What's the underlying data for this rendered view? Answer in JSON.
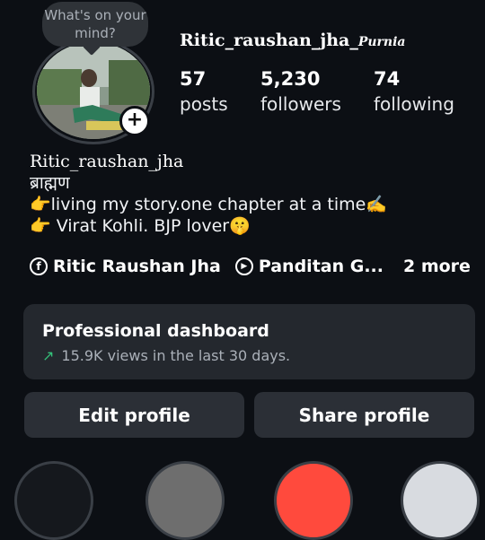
{
  "profile": {
    "note": "What's on your mind?",
    "username": "Ritic_raushan_jha_",
    "username_tag": "Purnia",
    "stats": [
      {
        "value": "57",
        "label": "posts"
      },
      {
        "value": "5,230",
        "label": "followers"
      },
      {
        "value": "74",
        "label": "following"
      }
    ]
  },
  "bio": {
    "display_name": "Ritic_raushan_jha",
    "line1": "ब्राह्मण",
    "line2": "👉living my story.one chapter at a time✍️",
    "line3": "👉 Virat Kohli. BJP lover🤫"
  },
  "links": {
    "facebook": "Ritic Raushan Jha",
    "threads": "Panditan G...",
    "more": "2 more"
  },
  "dashboard": {
    "title": "Professional dashboard",
    "views": "15.9K views in the last 30 days.",
    "accent": "#34c27a"
  },
  "actions": {
    "edit": "Edit profile",
    "share": "Share profile"
  },
  "icons": {
    "add": "+",
    "facebook": "f",
    "threads": "▶",
    "trend": "↗"
  }
}
